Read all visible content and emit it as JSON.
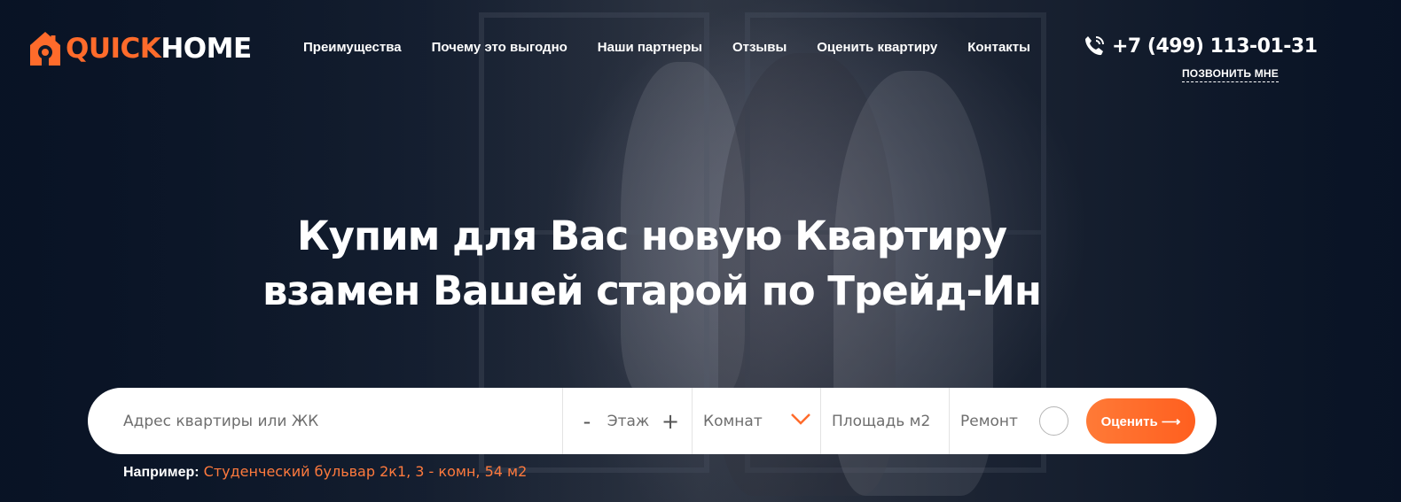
{
  "logo": {
    "part1": "QUICK",
    "part2": "HOME"
  },
  "nav": [
    {
      "label": "Преимущества"
    },
    {
      "label": "Почему это выгодно"
    },
    {
      "label": "Наши партнеры"
    },
    {
      "label": "Отзывы"
    },
    {
      "label": "Оценить квартиру"
    },
    {
      "label": "Контакты"
    }
  ],
  "contact": {
    "phone": "+7 (499) 113-01-31",
    "callback_label": "ПОЗВОНИТЬ МНЕ"
  },
  "hero": {
    "title_line1": "Купим для Вас новую Квартиру",
    "title_line2": "взамен Вашей старой по Трейд-Ин"
  },
  "form": {
    "address_placeholder": "Адрес квартиры или ЖК",
    "floor_minus": "-",
    "floor_label": "Этаж",
    "floor_plus": "+",
    "rooms_label": "Комнат",
    "area_placeholder": "Площадь м2",
    "repair_label": "Ремонт",
    "submit_label": "Оценить ⟶"
  },
  "example": {
    "label": "Например:",
    "value": "Студенческий бульвар 2к1, 3 - комн, 54 м2"
  },
  "colors": {
    "accent": "#ff6b2b",
    "dark_bg": "#0f1a2b",
    "text": "#ffffff"
  }
}
